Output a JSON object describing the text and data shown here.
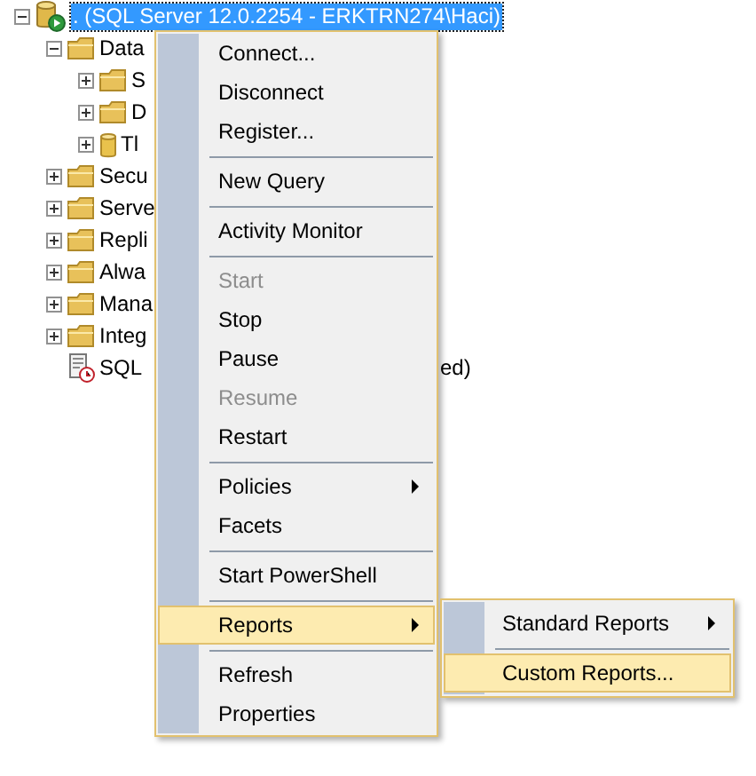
{
  "tree": [
    {
      "label": ". (SQL Server 12.0.2254 - ERKTRN274\\Haci)",
      "kind": "server",
      "expanded": true,
      "selected": true,
      "children": [
        {
          "label": "Data",
          "kind": "folder",
          "expanded": true,
          "selected": false,
          "children": [
            {
              "label": "S",
              "kind": "folder",
              "expanded": false,
              "selected": false
            },
            {
              "label": "D",
              "kind": "folder",
              "expanded": false,
              "selected": false
            },
            {
              "label": "Tl",
              "kind": "database",
              "expanded": false,
              "selected": false
            }
          ]
        },
        {
          "label": "Secu",
          "kind": "folder",
          "expanded": false,
          "selected": false
        },
        {
          "label": "Serve",
          "kind": "folder",
          "expanded": false,
          "selected": false
        },
        {
          "label": "Repli",
          "kind": "folder",
          "expanded": false,
          "selected": false
        },
        {
          "label": "Alwa",
          "kind": "folder",
          "expanded": false,
          "selected": false
        },
        {
          "label": "Mana",
          "kind": "folder",
          "expanded": false,
          "selected": false
        },
        {
          "label": "Integ",
          "kind": "folder",
          "expanded": false,
          "selected": false
        },
        {
          "label": "SQL",
          "label_tail": "ed)",
          "kind": "agent",
          "selected": false
        }
      ]
    }
  ],
  "context_menu": {
    "groups": [
      [
        {
          "label": "Connect...",
          "disabled": false,
          "selected": false,
          "has_submenu": false
        },
        {
          "label": "Disconnect",
          "disabled": false,
          "selected": false,
          "has_submenu": false
        },
        {
          "label": "Register...",
          "disabled": false,
          "selected": false,
          "has_submenu": false
        }
      ],
      [
        {
          "label": "New Query",
          "disabled": false,
          "selected": false,
          "has_submenu": false
        }
      ],
      [
        {
          "label": "Activity Monitor",
          "disabled": false,
          "selected": false,
          "has_submenu": false
        }
      ],
      [
        {
          "label": "Start",
          "disabled": true,
          "selected": false,
          "has_submenu": false
        },
        {
          "label": "Stop",
          "disabled": false,
          "selected": false,
          "has_submenu": false
        },
        {
          "label": "Pause",
          "disabled": false,
          "selected": false,
          "has_submenu": false
        },
        {
          "label": "Resume",
          "disabled": true,
          "selected": false,
          "has_submenu": false
        },
        {
          "label": "Restart",
          "disabled": false,
          "selected": false,
          "has_submenu": false
        }
      ],
      [
        {
          "label": "Policies",
          "disabled": false,
          "selected": false,
          "has_submenu": true
        },
        {
          "label": "Facets",
          "disabled": false,
          "selected": false,
          "has_submenu": false
        }
      ],
      [
        {
          "label": "Start PowerShell",
          "disabled": false,
          "selected": false,
          "has_submenu": false
        }
      ],
      [
        {
          "label": "Reports",
          "disabled": false,
          "selected": true,
          "has_submenu": true
        }
      ],
      [
        {
          "label": "Refresh",
          "disabled": false,
          "selected": false,
          "has_submenu": false
        },
        {
          "label": "Properties",
          "disabled": false,
          "selected": false,
          "has_submenu": false
        }
      ]
    ]
  },
  "submenu": {
    "groups": [
      [
        {
          "label": "Standard Reports",
          "disabled": false,
          "selected": false,
          "has_submenu": true
        }
      ],
      [
        {
          "label": "Custom Reports...",
          "disabled": false,
          "selected": true,
          "has_submenu": false
        }
      ]
    ]
  }
}
